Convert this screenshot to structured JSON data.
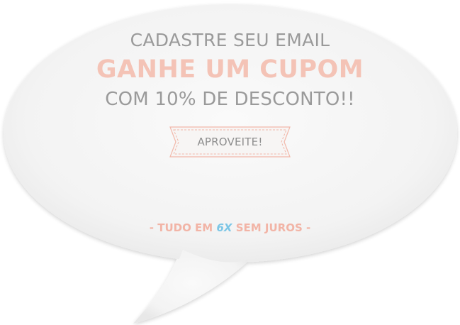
{
  "promo": {
    "line1": "CADASTRE SEU EMAIL",
    "line2": "GANHE UM CUPOM",
    "line3": "COM 10% DE DESCONTO!!",
    "cta_label": "APROVEITE!",
    "footer": {
      "prefix": "- TUDO EM ",
      "highlight": "6X",
      "suffix": " SEM JUROS -"
    }
  },
  "colors": {
    "bubble_fill": "#f4f4f4",
    "bubble_shadow": "#e2e2e2",
    "text_gray": "#9a9a9a",
    "accent_pink": "#f4c3b6",
    "accent_blue": "#7cc6e6",
    "ribbon_border": "#f2b8aa"
  }
}
